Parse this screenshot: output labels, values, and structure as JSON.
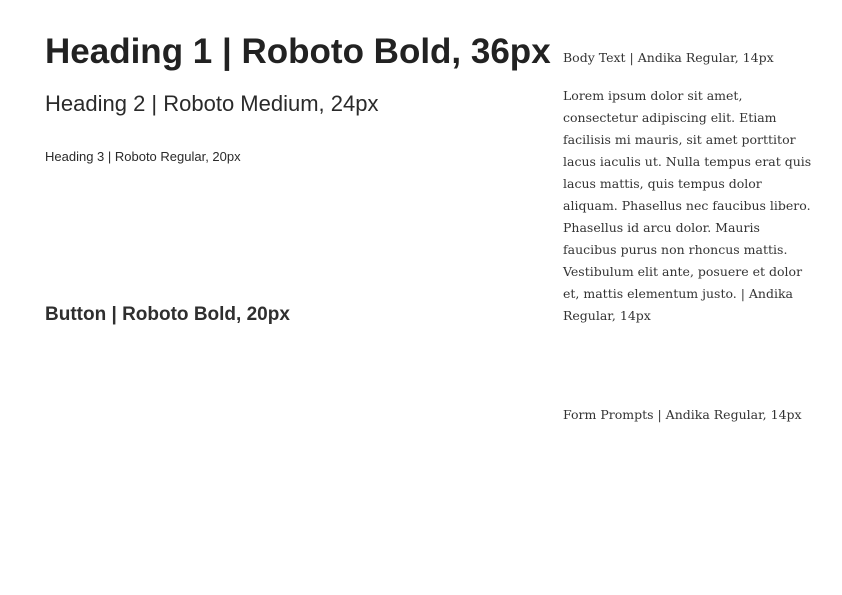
{
  "typography": {
    "heading1": "Heading 1 | Roboto Bold, 36px",
    "heading2": "Heading 2 | Roboto Medium, 24px",
    "heading3": "Heading 3 | Roboto Regular, 20px",
    "button": "Button | Roboto Bold, 20px",
    "body_label": "Body Text | Andika Regular, 14px",
    "body_paragraph": "Lorem ipsum dolor sit amet, consectetur adipiscing elit. Etiam facilisis mi mauris, sit amet porttitor lacus iaculis ut. Nulla tempus erat quis lacus mattis, quis tempus dolor aliquam. Phasellus nec faucibus libero. Phasellus id arcu dolor. Mauris faucibus purus non rhoncus mattis. Vestibulum elit ante, posuere et dolor et, mattis elementum justo. | Andika Regular, 14px",
    "form_prompts": "Form Prompts | Andika Regular, 14px"
  },
  "colors": {
    "text": "#222222",
    "background": "#ffffff"
  }
}
